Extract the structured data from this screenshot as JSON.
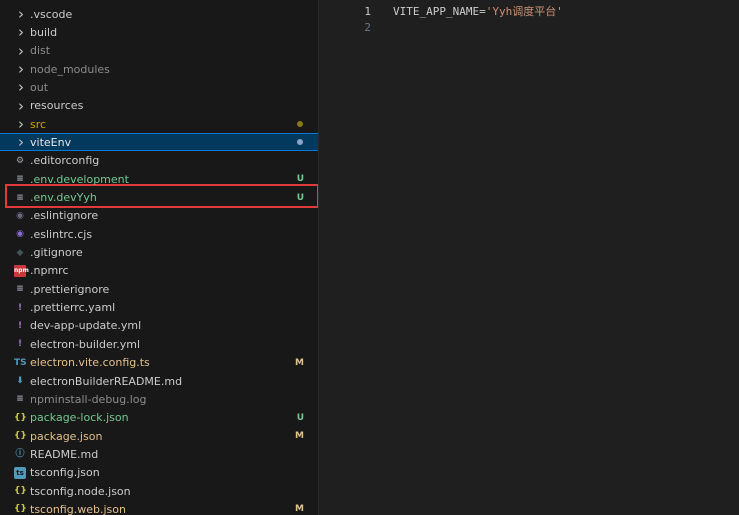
{
  "explorer": {
    "items": [
      {
        "label": ".vscode",
        "kind": "folder",
        "color": "#cccccc"
      },
      {
        "label": "build",
        "kind": "folder",
        "color": "#cccccc"
      },
      {
        "label": "dist",
        "kind": "folder",
        "color": "#8c8c8c"
      },
      {
        "label": "node_modules",
        "kind": "folder",
        "color": "#8c8c8c"
      },
      {
        "label": "out",
        "kind": "folder",
        "color": "#8c8c8c"
      },
      {
        "label": "resources",
        "kind": "folder",
        "color": "#cccccc"
      },
      {
        "label": "src",
        "kind": "folder",
        "color": "#cca700",
        "dot": "#8a7a1a"
      },
      {
        "label": "viteEnv",
        "kind": "folder",
        "color": "#e8e8e8",
        "selected": true,
        "dot": "#8aa4c8"
      },
      {
        "label": ".editorconfig",
        "kind": "file",
        "icon": "gear-icon",
        "glyph": "⚙",
        "iconColor": "#9da5b4",
        "color": "#cccccc"
      },
      {
        "label": ".env.development",
        "kind": "file",
        "icon": "lines-icon",
        "glyph": "≡",
        "iconColor": "#9da5b4",
        "color": "#73c991",
        "badge": "U",
        "badgeColor": "#73c991"
      },
      {
        "label": ".env.devYyh",
        "kind": "file",
        "icon": "lines-icon",
        "glyph": "≡",
        "iconColor": "#9da5b4",
        "color": "#73c991",
        "badge": "U",
        "badgeColor": "#73c991"
      },
      {
        "label": ".eslintignore",
        "kind": "file",
        "icon": "circle-icon",
        "glyph": "◉",
        "iconColor": "#6b6b8a",
        "color": "#cccccc"
      },
      {
        "label": ".eslintrc.cjs",
        "kind": "file",
        "icon": "eslint-icon",
        "glyph": "◉",
        "iconColor": "#8d6bd6",
        "color": "#cccccc"
      },
      {
        "label": ".gitignore",
        "kind": "file",
        "icon": "git-icon",
        "glyph": "◆",
        "iconColor": "#41535b",
        "color": "#cccccc"
      },
      {
        "label": ".npmrc",
        "kind": "file",
        "icon": "npm-icon",
        "glyph": "npm",
        "iconColor": "#cb3837",
        "color": "#cccccc"
      },
      {
        "label": ".prettierignore",
        "kind": "file",
        "icon": "lines-icon",
        "glyph": "≡",
        "iconColor": "#9da5b4",
        "color": "#cccccc"
      },
      {
        "label": ".prettierrc.yaml",
        "kind": "file",
        "icon": "yaml-icon",
        "glyph": "!",
        "iconColor": "#a074c4",
        "color": "#cccccc"
      },
      {
        "label": "dev-app-update.yml",
        "kind": "file",
        "icon": "yaml-icon",
        "glyph": "!",
        "iconColor": "#a074c4",
        "color": "#cccccc"
      },
      {
        "label": "electron-builder.yml",
        "kind": "file",
        "icon": "yaml-icon",
        "glyph": "!",
        "iconColor": "#a074c4",
        "color": "#cccccc"
      },
      {
        "label": "electron.vite.config.ts",
        "kind": "file",
        "icon": "typescript-icon",
        "glyph": "TS",
        "iconColor": "#519aba",
        "color": "#e2c08d",
        "badge": "M",
        "badgeColor": "#e2c08d"
      },
      {
        "label": "electronBuilderREADME.md",
        "kind": "file",
        "icon": "markdown-icon",
        "glyph": "⬇",
        "iconColor": "#519aba",
        "color": "#cccccc"
      },
      {
        "label": "npminstall-debug.log",
        "kind": "file",
        "icon": "lines-icon",
        "glyph": "≡",
        "iconColor": "#9da5b4",
        "color": "#8c8c8c"
      },
      {
        "label": "package-lock.json",
        "kind": "file",
        "icon": "json-icon",
        "glyph": "{}",
        "iconColor": "#cbcb41",
        "color": "#73c991",
        "badge": "U",
        "badgeColor": "#73c991"
      },
      {
        "label": "package.json",
        "kind": "file",
        "icon": "json-icon",
        "glyph": "{}",
        "iconColor": "#cbcb41",
        "color": "#e2c08d",
        "badge": "M",
        "badgeColor": "#e2c08d"
      },
      {
        "label": "README.md",
        "kind": "file",
        "icon": "info-icon",
        "glyph": "ⓘ",
        "iconColor": "#519aba",
        "color": "#cccccc"
      },
      {
        "label": "tsconfig.json",
        "kind": "file",
        "icon": "tsconfig-icon",
        "glyph": "ts",
        "iconColor": "#519aba",
        "color": "#cccccc"
      },
      {
        "label": "tsconfig.node.json",
        "kind": "file",
        "icon": "json-icon",
        "glyph": "{}",
        "iconColor": "#cbcb41",
        "color": "#cccccc"
      },
      {
        "label": "tsconfig.web.json",
        "kind": "file",
        "icon": "json-icon",
        "glyph": "{}",
        "iconColor": "#cbcb41",
        "color": "#e2c08d",
        "badge": "M",
        "badgeColor": "#e2c08d"
      }
    ]
  },
  "editor": {
    "lines": [
      {
        "number": "1",
        "key": "VITE_APP_NAME=",
        "value": "'Yyh调度平台'"
      },
      {
        "number": "2",
        "key": "",
        "value": ""
      }
    ]
  }
}
